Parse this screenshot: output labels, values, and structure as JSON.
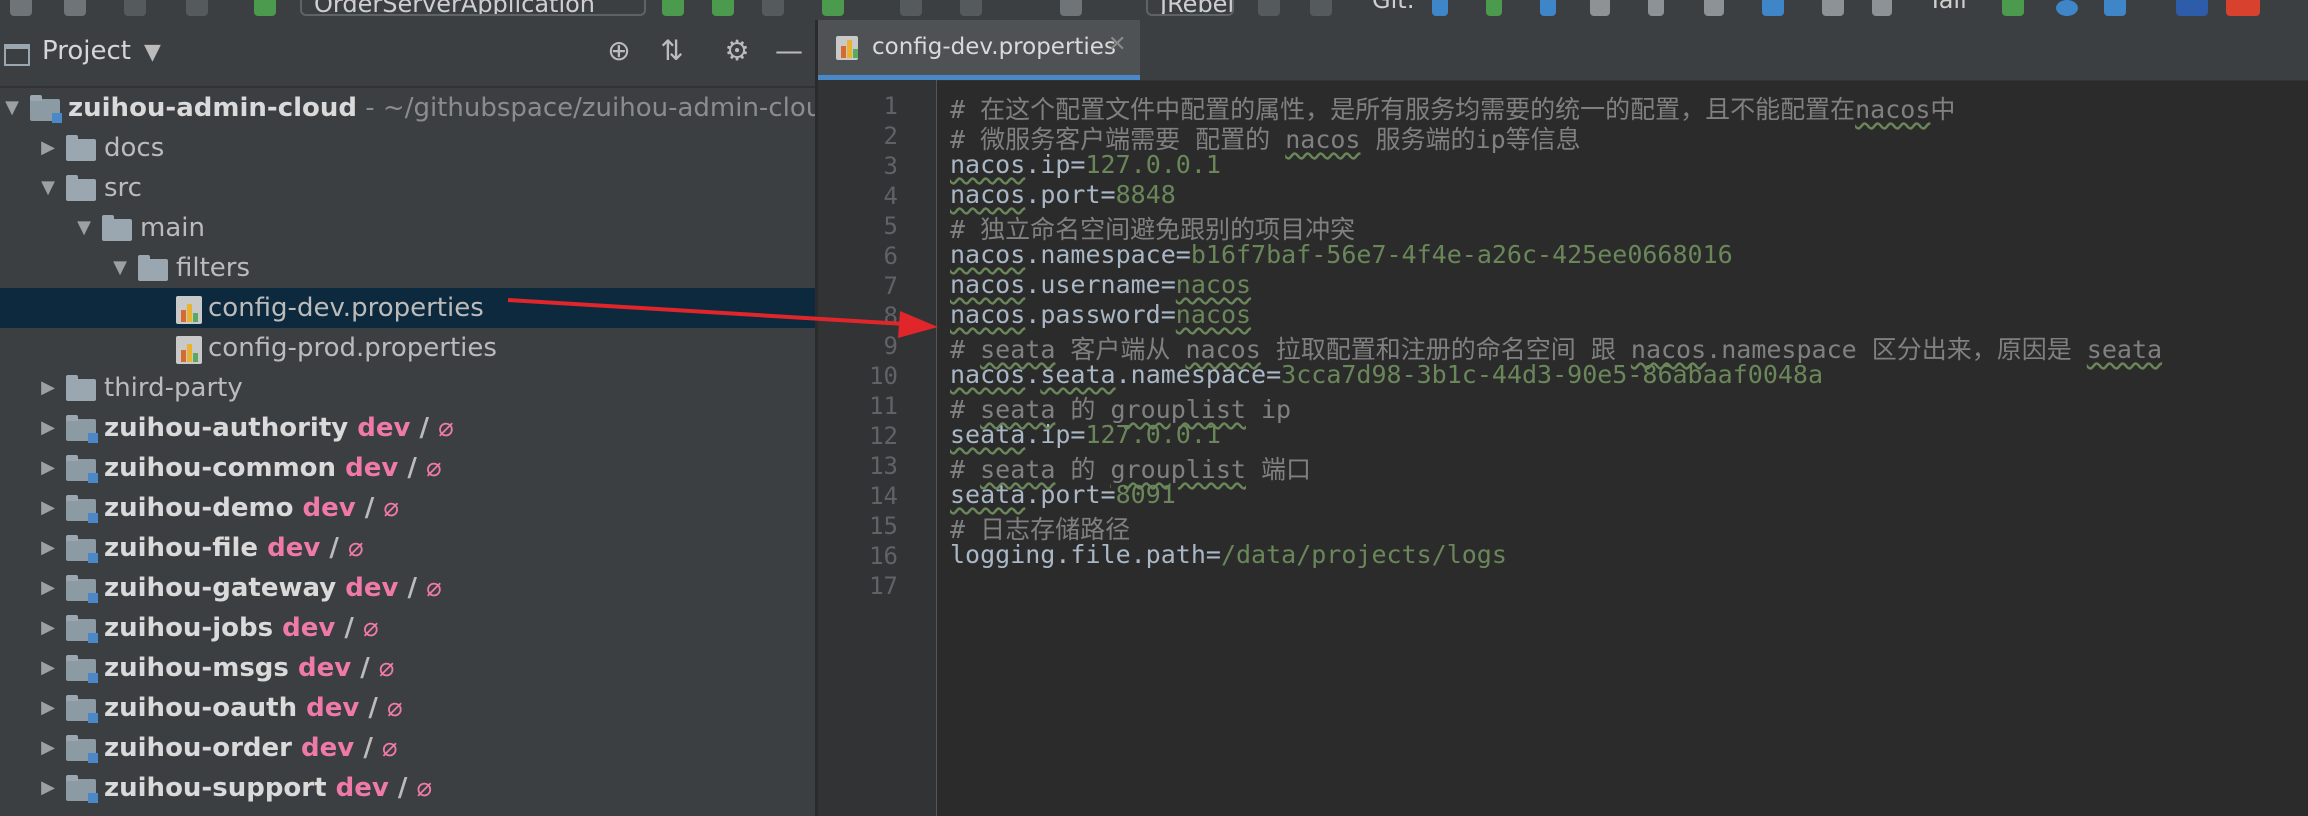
{
  "toolbar": {
    "run_config": "OrderServerApplication",
    "user_select": "JRebel",
    "git_label": "Git:",
    "tail_label": "Tail"
  },
  "project_panel": {
    "title": "Project",
    "tree": [
      {
        "label": "zuihou-admin-cloud",
        "path": " - ~/githubspace/zuihou-admin-cloud",
        "bold": true,
        "depth": 0,
        "expanded": true,
        "kind": "module"
      },
      {
        "label": "docs",
        "depth": 1,
        "expanded": false,
        "kind": "folder"
      },
      {
        "label": "src",
        "depth": 1,
        "expanded": true,
        "kind": "folder"
      },
      {
        "label": "main",
        "depth": 2,
        "expanded": true,
        "kind": "folder"
      },
      {
        "label": "filters",
        "depth": 3,
        "expanded": true,
        "kind": "folder"
      },
      {
        "label": "config-dev.properties",
        "depth": 4,
        "kind": "file",
        "selected": true
      },
      {
        "label": "config-prod.properties",
        "depth": 4,
        "kind": "file"
      },
      {
        "label": "third-party",
        "depth": 1,
        "expanded": false,
        "kind": "folder"
      },
      {
        "label": "zuihou-authority",
        "depth": 1,
        "expanded": false,
        "kind": "module",
        "bold": true,
        "branch": "dev",
        "sep": "/",
        "tag": "⌀"
      },
      {
        "label": "zuihou-common",
        "depth": 1,
        "expanded": false,
        "kind": "module",
        "bold": true,
        "branch": "dev",
        "sep": "/",
        "tag": "⌀"
      },
      {
        "label": "zuihou-demo",
        "depth": 1,
        "expanded": false,
        "kind": "module",
        "bold": true,
        "branch": "dev",
        "sep": "/",
        "tag": "⌀"
      },
      {
        "label": "zuihou-file",
        "depth": 1,
        "expanded": false,
        "kind": "module",
        "bold": true,
        "branch": "dev",
        "sep": "/",
        "tag": "⌀"
      },
      {
        "label": "zuihou-gateway",
        "depth": 1,
        "expanded": false,
        "kind": "module",
        "bold": true,
        "branch": "dev",
        "sep": "/",
        "tag": "⌀"
      },
      {
        "label": "zuihou-jobs",
        "depth": 1,
        "expanded": false,
        "kind": "module",
        "bold": true,
        "branch": "dev",
        "sep": "/",
        "tag": "⌀"
      },
      {
        "label": "zuihou-msgs",
        "depth": 1,
        "expanded": false,
        "kind": "module",
        "bold": true,
        "branch": "dev",
        "sep": "/",
        "tag": "⌀"
      },
      {
        "label": "zuihou-oauth",
        "depth": 1,
        "expanded": false,
        "kind": "module",
        "bold": true,
        "branch": "dev",
        "sep": "/",
        "tag": "⌀"
      },
      {
        "label": "zuihou-order",
        "depth": 1,
        "expanded": false,
        "kind": "module",
        "bold": true,
        "branch": "dev",
        "sep": "/",
        "tag": "⌀"
      },
      {
        "label": "zuihou-support",
        "depth": 1,
        "expanded": false,
        "kind": "module",
        "bold": true,
        "branch": "dev",
        "sep": "/",
        "tag": "⌀"
      }
    ]
  },
  "editor": {
    "tab_label": "config-dev.properties",
    "lines": [
      {
        "n": "1",
        "type": "comment",
        "text": "# 在这个配置文件中配置的属性，是所有服务均需要的统一的配置，且不能配置在nacos中"
      },
      {
        "n": "2",
        "type": "comment",
        "text": "# 微服务客户端需要 配置的 nacos 服务端的ip等信息"
      },
      {
        "n": "3",
        "type": "prop",
        "key": "nacos.ip",
        "value": "127.0.0.1"
      },
      {
        "n": "4",
        "type": "prop",
        "key": "nacos.port",
        "value": "8848"
      },
      {
        "n": "5",
        "type": "comment",
        "text": "# 独立命名空间避免跟别的项目冲突"
      },
      {
        "n": "6",
        "type": "prop",
        "key": "nacos.namespace",
        "value": "b16f7baf-56e7-4f4e-a26c-425ee0668016"
      },
      {
        "n": "7",
        "type": "prop",
        "key": "nacos.username",
        "value": "nacos"
      },
      {
        "n": "8",
        "type": "prop",
        "key": "nacos.password",
        "value": "nacos"
      },
      {
        "n": "9",
        "type": "comment",
        "text": "# seata 客户端从 nacos 拉取配置和注册的命名空间 跟 nacos.namespace 区分出来，原因是 seata"
      },
      {
        "n": "10",
        "type": "prop",
        "key": "nacos.seata.namespace",
        "value": "3cca7d98-3b1c-44d3-90e5-86abaaf0048a"
      },
      {
        "n": "11",
        "type": "comment",
        "text": "# seata 的 grouplist ip"
      },
      {
        "n": "12",
        "type": "prop",
        "key": "seata.ip",
        "value": "127.0.0.1"
      },
      {
        "n": "13",
        "type": "comment",
        "text": "# seata 的 grouplist 端口"
      },
      {
        "n": "14",
        "type": "prop",
        "key": "seata.port",
        "value": "8091"
      },
      {
        "n": "15",
        "type": "comment",
        "text": "# 日志存储路径"
      },
      {
        "n": "16",
        "type": "prop",
        "key": "logging.file.path",
        "value": "/data/projects/logs"
      },
      {
        "n": "17",
        "type": "empty",
        "text": ""
      }
    ]
  },
  "colors": {
    "selection": "#0d293e",
    "branch": "#ef7aa9",
    "value": "#6a8759",
    "comment": "#808080",
    "arrow": "#e0262a",
    "tab_underline": "#4a88c7"
  }
}
